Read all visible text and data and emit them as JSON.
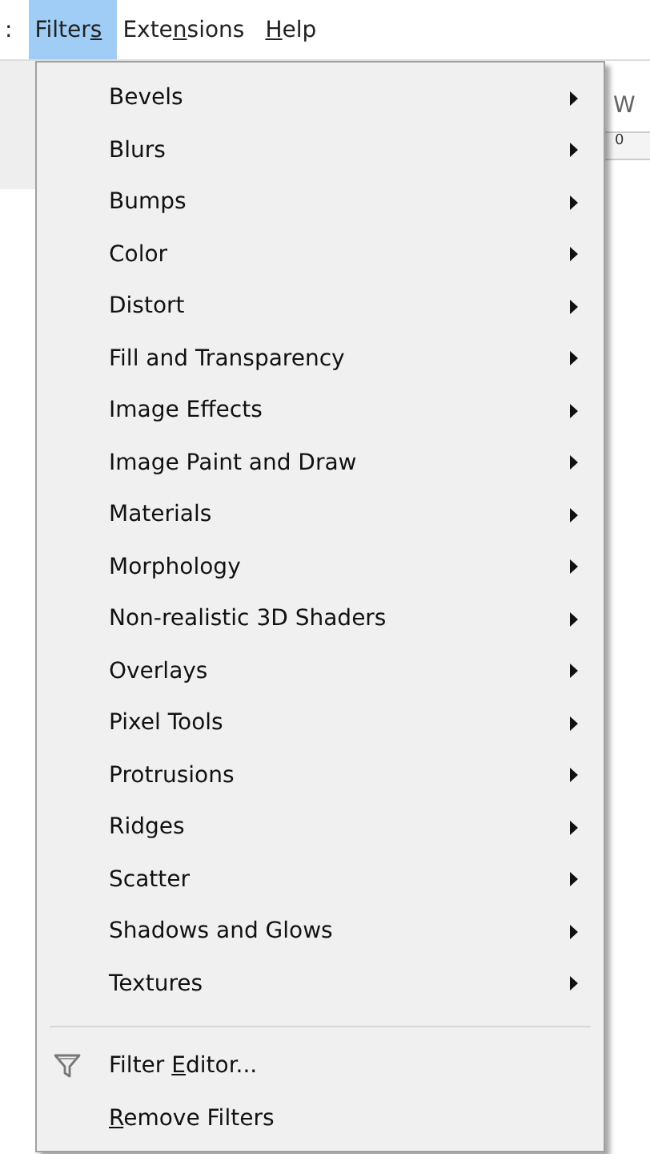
{
  "menubar": [
    {
      "pre": ":",
      "selected": false
    },
    {
      "pre": "Filter",
      "key": "s",
      "selected": true
    },
    {
      "pre": "Exte",
      "key": "n",
      "post": "sions",
      "selected": false
    },
    {
      "key": "H",
      "post": "elp",
      "selected": false
    }
  ],
  "background_texts": {
    "toolbar_label": "W",
    "ruler_label": "0"
  },
  "submenus": [
    "Bevels",
    "Blurs",
    "Bumps",
    "Color",
    "Distort",
    "Fill and Transparency",
    "Image Effects",
    "Image Paint and Draw",
    "Materials",
    "Morphology",
    "Non-realistic 3D Shaders",
    "Overlays",
    "Pixel Tools",
    "Protrusions",
    "Ridges",
    "Scatter",
    "Shadows and Glows",
    "Textures"
  ],
  "actions": [
    {
      "pre": "Filter ",
      "key": "E",
      "post": "ditor...",
      "icon": true
    },
    {
      "key": "R",
      "post": "emove Filters",
      "icon": false
    }
  ]
}
